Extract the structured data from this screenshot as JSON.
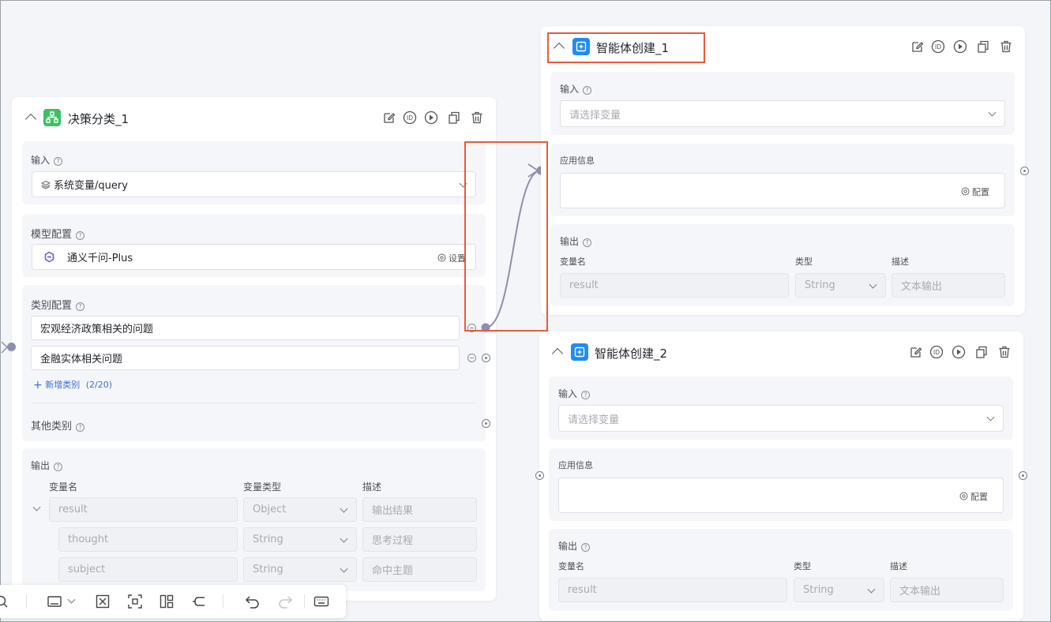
{
  "node_decision": {
    "title": "决策分类_1",
    "input_label": "输入",
    "input_value": "系统变量/query",
    "model_label": "模型配置",
    "model_value": "通义千问-Plus",
    "model_settings": "设置",
    "category_label": "类别配置",
    "categories": [
      "宏观经济政策相关的问题",
      "金融实体相关问题"
    ],
    "add_category": "新增类别",
    "add_category_count": "(2/20)",
    "other_category": "其他类别",
    "output_label": "输出",
    "col_name": "变量名",
    "col_type": "变量类型",
    "col_desc": "描述",
    "outputs": [
      {
        "name": "result",
        "type": "Object",
        "desc": "输出结果"
      },
      {
        "name": "thought",
        "type": "String",
        "desc": "思考过程"
      },
      {
        "name": "subject",
        "type": "String",
        "desc": "命中主题"
      }
    ]
  },
  "node_agent1": {
    "title": "智能体创建_1",
    "input_label": "输入",
    "input_placeholder": "请选择变量",
    "app_info_label": "应用信息",
    "config": "配置",
    "output_label": "输出",
    "col_name": "变量名",
    "col_type": "类型",
    "col_desc": "描述",
    "out_name": "result",
    "out_type": "String",
    "out_desc": "文本输出"
  },
  "node_agent2": {
    "title": "智能体创建_2",
    "input_label": "输入",
    "input_placeholder": "请选择变量",
    "app_info_label": "应用信息",
    "config": "配置",
    "output_label": "输出",
    "col_name": "变量名",
    "col_type": "类型",
    "col_desc": "描述",
    "out_name": "result",
    "out_type": "String",
    "out_desc": "文本输出"
  },
  "colors": {
    "decision_icon": "#3cbf62",
    "agent_icon": "#1f8cf5",
    "highlight": "#e85a3c",
    "connection": "#8e8fae"
  },
  "toolbar_icons": [
    "search-icon",
    "fit-view-icon",
    "zoom-fit-icon",
    "select-icon",
    "layout-icon",
    "branch-icon",
    "undo-icon",
    "redo-icon",
    "keyboard-icon"
  ]
}
